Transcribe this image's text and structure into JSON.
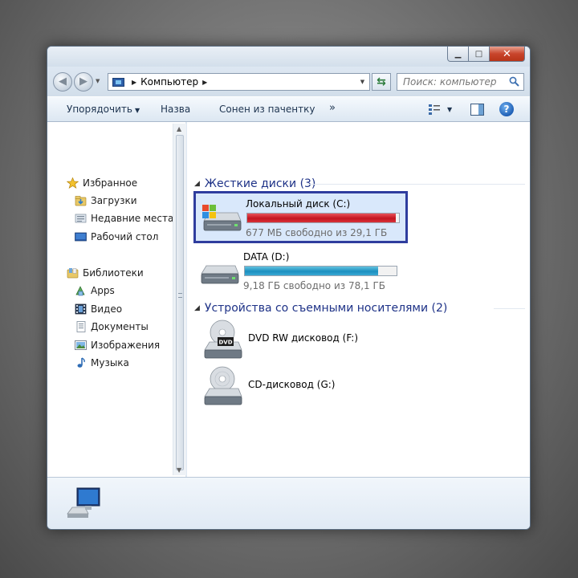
{
  "window": {
    "caption": {
      "minimize_glyph": "▁",
      "maximize_glyph": "□",
      "close_glyph": "✕"
    }
  },
  "navigation": {
    "back_glyph": "◀",
    "forward_glyph": "▶",
    "address": {
      "location": "Компьютер",
      "separator": "▶"
    },
    "refresh_glyph": "⇆",
    "search": {
      "placeholder": "Поиск: компьютер"
    }
  },
  "toolbar": {
    "organize_label": "Упорядочить",
    "organize_arrow": "▼",
    "name_label": "Назва",
    "burn_label": "Сонен из пачентку",
    "more_label": "»",
    "help_label": "?",
    "views_arrow": "▼"
  },
  "nav_pane": {
    "favorites": {
      "label": "Избранное",
      "items": [
        {
          "label": "Загрузки",
          "icon": "downloads-folder-icon"
        },
        {
          "label": "Недавние места",
          "icon": "recent-places-icon"
        },
        {
          "label": "Рабочий стол",
          "icon": "desktop-icon"
        }
      ]
    },
    "libraries": {
      "label": "Библиотеки",
      "items": [
        {
          "label": "Apps",
          "icon": "apps-icon"
        },
        {
          "label": "Видео",
          "icon": "video-icon"
        },
        {
          "label": "Документы",
          "icon": "documents-icon"
        },
        {
          "label": "Изображения",
          "icon": "pictures-icon"
        },
        {
          "label": "Музыка",
          "icon": "music-icon"
        }
      ]
    },
    "scroll_up_glyph": "▲",
    "scroll_down_glyph": "▼"
  },
  "content": {
    "hard_disks": {
      "header": "Жесткие диски (3)",
      "drives": [
        {
          "name": "Локальный диск (C:)",
          "free_text": "677 МБ свободно из 29,1 ГБ",
          "used_fraction": 0.977,
          "bar_color": "red"
        },
        {
          "name": "DATA (D:)",
          "free_text": "9,18 ГБ свободно из 78,1 ГБ",
          "used_fraction": 0.88,
          "bar_color": "blue"
        }
      ]
    },
    "removable": {
      "header": "Устройства со съемными носителями (2)",
      "devices": [
        {
          "name": "DVD RW дисковод (F:)",
          "badge": "DVD"
        },
        {
          "name": "CD-дисковод (G:)"
        }
      ]
    },
    "collapse_glyph": "◢"
  },
  "colors": {
    "selection_border": "#2f3d9e",
    "bar_red": "#c4141f",
    "bar_blue": "#1c8fbf",
    "group_header": "#1e3287"
  }
}
